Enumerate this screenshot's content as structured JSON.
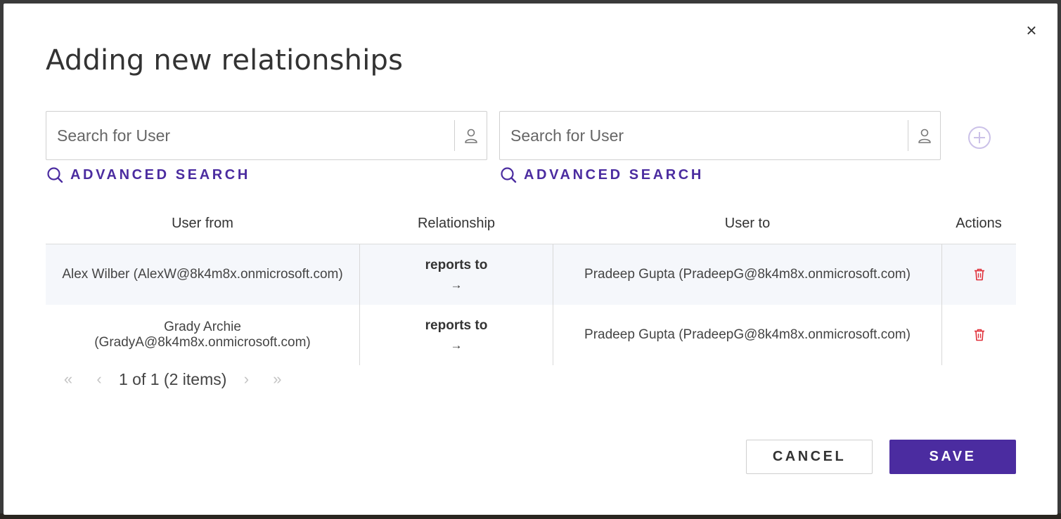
{
  "dialog": {
    "title": "Adding new relationships",
    "close_symbol": "×"
  },
  "search_left": {
    "placeholder": "Search for User",
    "advanced_label": "ADVANCED SEARCH",
    "icon": "person-icon"
  },
  "search_right": {
    "placeholder": "Search for User",
    "advanced_label": "ADVANCED SEARCH",
    "icon": "person-icon"
  },
  "add_icon": "plus-circle-icon",
  "table": {
    "headers": [
      "User from",
      "Relationship",
      "User to",
      "Actions"
    ],
    "rows": [
      {
        "user_from_line1": "Alex Wilber (AlexW@8k4m8x.onmicrosoft.com)",
        "user_from_line2": "",
        "relationship": "reports to",
        "arrow": "→",
        "user_to": "Pradeep Gupta (PradeepG@8k4m8x.onmicrosoft.com)",
        "action_icon": "trash-icon"
      },
      {
        "user_from_line1": "Grady Archie",
        "user_from_line2": "(GradyA@8k4m8x.onmicrosoft.com)",
        "relationship": "reports to",
        "arrow": "→",
        "user_to": "Pradeep Gupta (PradeepG@8k4m8x.onmicrosoft.com)",
        "action_icon": "trash-icon"
      }
    ]
  },
  "pager": {
    "first": "«",
    "prev": "‹",
    "info": "1 of 1 (2 items)",
    "next": "›",
    "last": "»"
  },
  "buttons": {
    "cancel": "CANCEL",
    "save": "SAVE"
  },
  "colors": {
    "accent": "#4b2ca0",
    "delete": "#e0303a",
    "row_alt": "#f5f7fb"
  }
}
